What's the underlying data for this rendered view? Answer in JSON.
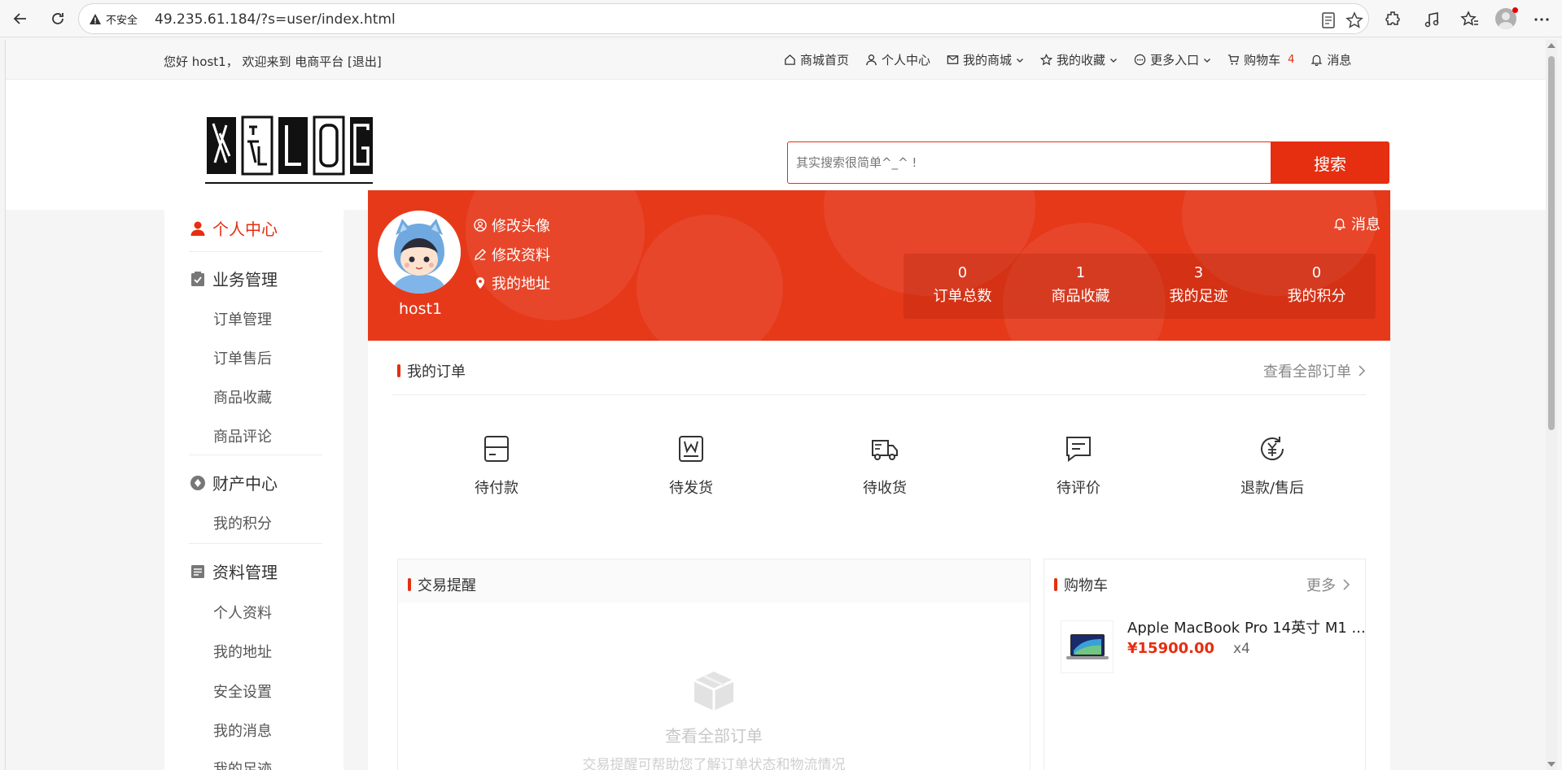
{
  "browser": {
    "security_label": "不安全",
    "url": "49.235.61.184/?s=user/index.html"
  },
  "topbar": {
    "welcome": "您好 host1， 欢迎来到 电商平台 [退出]",
    "nav": [
      {
        "label": "商城首页"
      },
      {
        "label": "个人中心"
      },
      {
        "label": "我的商城"
      },
      {
        "label": "我的收藏"
      },
      {
        "label": "更多入口"
      },
      {
        "label": "购物车",
        "badge": "4"
      },
      {
        "label": "消息"
      }
    ]
  },
  "search": {
    "placeholder": "其实搜索很简单^_^ !",
    "button": "搜索"
  },
  "sidebar": {
    "groups": [
      {
        "title": "个人中心",
        "items": []
      },
      {
        "title": "业务管理",
        "items": [
          "订单管理",
          "订单售后",
          "商品收藏",
          "商品评论"
        ]
      },
      {
        "title": "财产中心",
        "items": [
          "我的积分"
        ]
      },
      {
        "title": "资料管理",
        "items": [
          "个人资料",
          "我的地址",
          "安全设置",
          "我的消息",
          "我的足迹"
        ]
      }
    ]
  },
  "profile": {
    "username": "host1",
    "links": [
      "修改头像",
      "修改资料",
      "我的地址"
    ],
    "message": "消息",
    "stats": [
      {
        "value": "0",
        "label": "订单总数"
      },
      {
        "value": "1",
        "label": "商品收藏"
      },
      {
        "value": "3",
        "label": "我的足迹"
      },
      {
        "value": "0",
        "label": "我的积分"
      }
    ]
  },
  "orders": {
    "title": "我的订单",
    "view_all": "查看全部订单",
    "statuses": [
      "待付款",
      "待发货",
      "待收货",
      "待评价",
      "退款/售后"
    ]
  },
  "trade": {
    "title": "交易提醒",
    "empty_title": "查看全部订单",
    "empty_sub": "交易提醒可帮助您了解订单状态和物流情况"
  },
  "cart": {
    "title": "购物车",
    "more": "更多",
    "items": [
      {
        "name": "Apple MacBook Pro 14英寸 M1 ...",
        "price": "¥15900.00",
        "qty": "x4"
      }
    ]
  }
}
